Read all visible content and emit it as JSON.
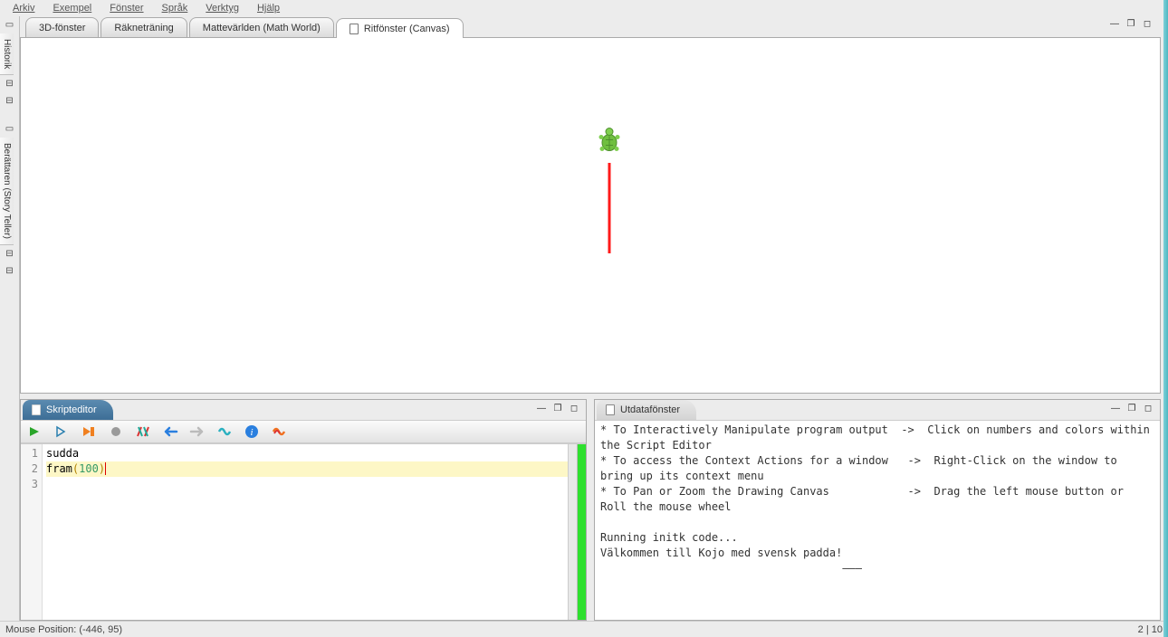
{
  "menu": {
    "arkiv": "Arkiv",
    "exempel": "Exempel",
    "fonster": "Fönster",
    "sprak": "Språk",
    "verktyg": "Verktyg",
    "hjalp": "Hjälp"
  },
  "leftRail": {
    "historik": "Historik",
    "berattaren": "Berättaren (Story Teller)"
  },
  "tabs": {
    "t0": "3D-fönster",
    "t1": "Räkneträning",
    "t2": "Mattevärlden (Math World)",
    "t3": "Ritfönster (Canvas)"
  },
  "winControlsGlyphs": {
    "min": "—",
    "max": "◻",
    "restore": "❐"
  },
  "scriptEditor": {
    "title": "Skripteditor",
    "lines": {
      "n1": "1",
      "n2": "2",
      "n3": "3",
      "l1": "sudda",
      "l2a": "fram",
      "l2b": "(",
      "l2c": "100",
      "l2d": ")"
    }
  },
  "output": {
    "title": "Utdatafönster",
    "text": "* To Interactively Manipulate program output  ->  Click on numbers and colors within the Script Editor\n* To access the Context Actions for a window   ->  Right-Click on the window to bring up its context menu\n* To Pan or Zoom the Drawing Canvas            ->  Drag the left mouse button or Roll the mouse wheel\n\nRunning initk code...\nVälkommen till Kojo med svensk padda!\n                                     ———"
  },
  "status": {
    "left": "Mouse Position: (-446, 95)",
    "right": "2 | 10"
  }
}
